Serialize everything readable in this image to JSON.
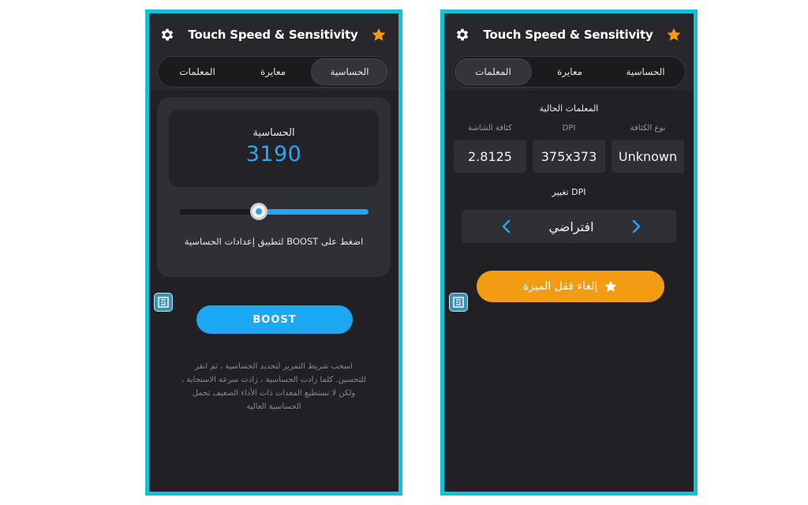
{
  "app": {
    "title": "Touch Speed & Sensitivity",
    "accent_color": "#14c0d6",
    "blue": "#1da8f4",
    "orange": "#f39b12"
  },
  "tabs": [
    "المعلمات",
    "معايرة",
    "الحساسية"
  ],
  "left_screen": {
    "active_tab": "الحساسية",
    "sensitivity_label": "الحساسية",
    "sensitivity_value": "3190",
    "slider_level": 0.42,
    "hint": "اضغط على BOOST لتطبيق إعدادات الحساسية",
    "boost_label": "BOOST",
    "description": "اسحب شريط التمرير لتحديد الحساسية ، ثم انقر للتحسين. كلما زادت الحساسية ، زادت سرعة الاستجابة ، ولكن لا تستطيع المعدات ذات الأداء الضعيف تحمل الحساسية العالية"
  },
  "right_screen": {
    "active_tab": "المعلمات",
    "current_params_title": "المعلمات الحالية",
    "columns": [
      {
        "header": "كثافة الشاشة",
        "value": "2.8125"
      },
      {
        "header": "DPI",
        "value": "375x373"
      },
      {
        "header": "نوع الكثافة",
        "value": "Unknown"
      }
    ],
    "change_dpi_title": "تغيير DPI",
    "dpi_option": "افتراضي",
    "unlock_label": "إلغاء قفل الميزة"
  }
}
